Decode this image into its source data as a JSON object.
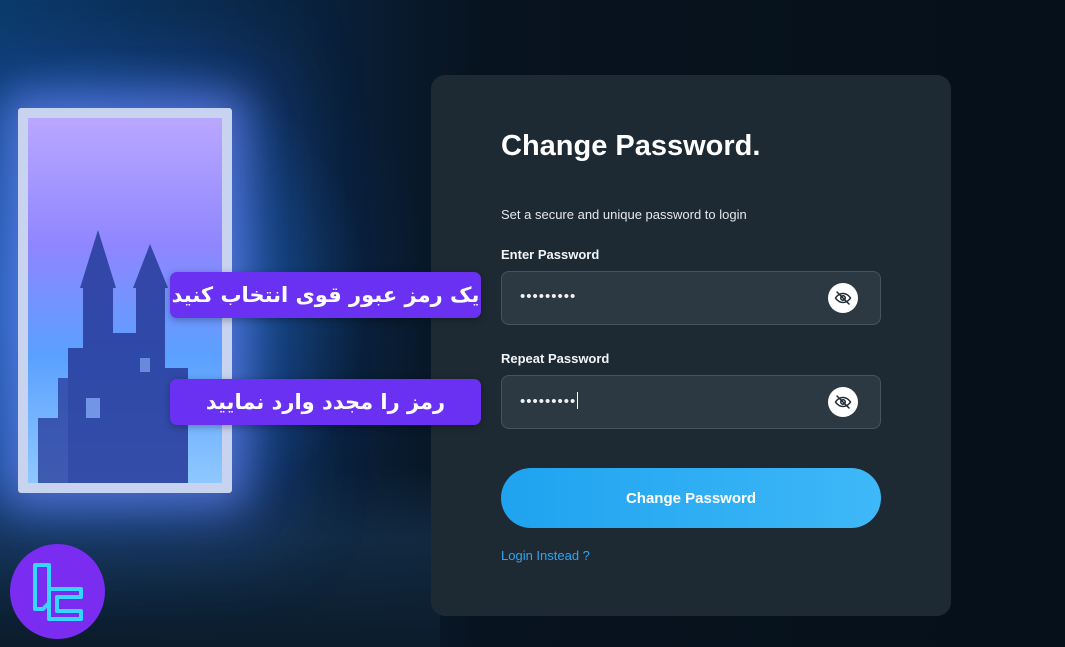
{
  "form": {
    "title": "Change Password.",
    "subtitle": "Set a secure and unique password to login",
    "enter_password_label": "Enter Password",
    "enter_password_value": "•••••••••",
    "repeat_password_label": "Repeat Password",
    "repeat_password_value": "•••••••••",
    "submit_label": "Change Password",
    "login_link": "Login Instead ?",
    "visibility_icon": "eye-off-icon"
  },
  "annotations": {
    "tag1": "یک رمز عبور قوی انتخاب کنید",
    "tag2": "رمز را مجدد وارد نمایید"
  },
  "colors": {
    "card_bg": "#1e2a33",
    "accent": "#2fa6f3",
    "tag_bg": "#6a31f3",
    "logo_bg": "#7a2cf0"
  }
}
